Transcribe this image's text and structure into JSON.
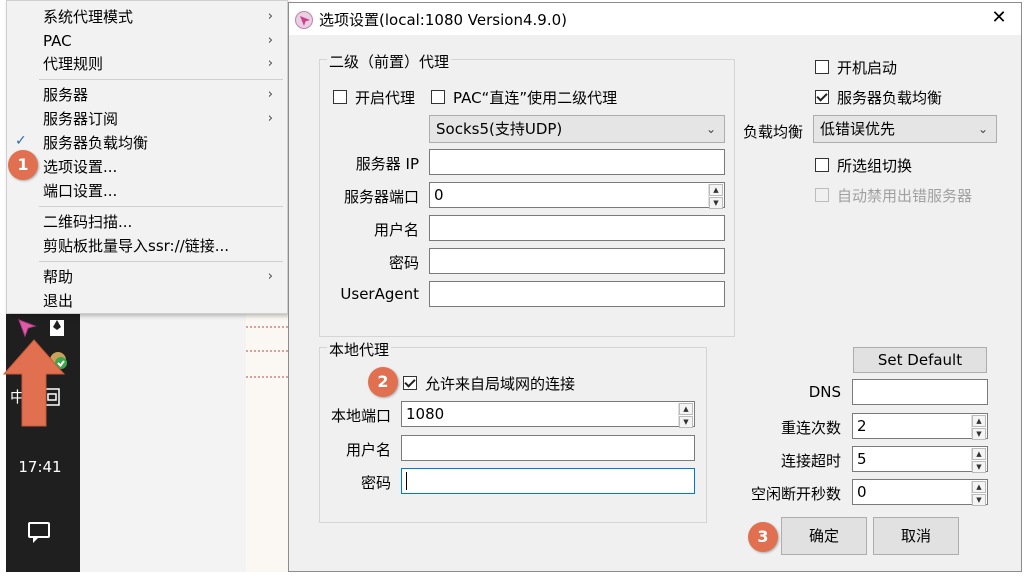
{
  "tray_menu": {
    "items": [
      {
        "label": "系统代理模式",
        "submenu": true
      },
      {
        "label": "PAC",
        "submenu": true
      },
      {
        "label": "代理规则",
        "submenu": true
      },
      {
        "label": "服务器",
        "submenu": true
      },
      {
        "label": "服务器订阅",
        "submenu": true
      },
      {
        "label": "服务器负载均衡",
        "checked": true
      },
      {
        "label": "选项设置..."
      },
      {
        "label": "端口设置..."
      },
      {
        "label": "二维码扫描..."
      },
      {
        "label": "剪贴板批量导入ssr://链接..."
      },
      {
        "label": "帮助",
        "submenu": true
      },
      {
        "label": "退出"
      }
    ],
    "submenu_arrow": "›",
    "check_mark": "✓"
  },
  "taskbar": {
    "clock": "17:41",
    "ime_label": "中",
    "tray_glyph": "ⅿ"
  },
  "dialog": {
    "title": "选项设置(local:1080 Version4.9.0)",
    "close_glyph": "✕",
    "secondary_proxy": {
      "group_title": "二级（前置）代理",
      "enable_label": "开启代理",
      "enable_checked": false,
      "pac_direct_label": "PAC“直连”使用二级代理",
      "pac_direct_checked": false,
      "proxy_type": "Socks5(支持UDP)",
      "server_ip_label": "服务器 IP",
      "server_ip_value": "",
      "server_port_label": "服务器端口",
      "server_port_value": "0",
      "username_label": "用户名",
      "username_value": "",
      "password_label": "密码",
      "password_value": "",
      "useragent_label": "UserAgent",
      "useragent_value": ""
    },
    "local_proxy": {
      "group_title": "本地代理",
      "allow_lan_label": "允许来自局域网的连接",
      "allow_lan_checked": true,
      "port_label": "本地端口",
      "port_value": "1080",
      "username_label": "用户名",
      "username_value": "",
      "password_label": "密码",
      "password_value": ""
    },
    "general": {
      "autostart_label": "开机启动",
      "autostart_checked": false,
      "balance_label": "服务器负载均衡",
      "balance_checked": true,
      "balance_mode_label": "负载均衡",
      "balance_mode_value": "低错误优先",
      "group_switch_label": "所选组切换",
      "group_switch_checked": false,
      "auto_ban_label": "自动禁用出错服务器",
      "auto_ban_checked": false
    },
    "network": {
      "set_default_label": "Set Default",
      "dns_label": "DNS",
      "dns_value": "",
      "reconnect_label": "重连次数",
      "reconnect_value": "2",
      "timeout_label": "连接超时",
      "timeout_value": "5",
      "idle_label": "空闲断开秒数",
      "idle_value": "0"
    },
    "ok_label": "确定",
    "cancel_label": "取消"
  },
  "callouts": [
    "1",
    "2",
    "3"
  ],
  "colors": {
    "callout": "#e0704f",
    "arrow": "#e0704f",
    "focus": "#0078d7"
  }
}
